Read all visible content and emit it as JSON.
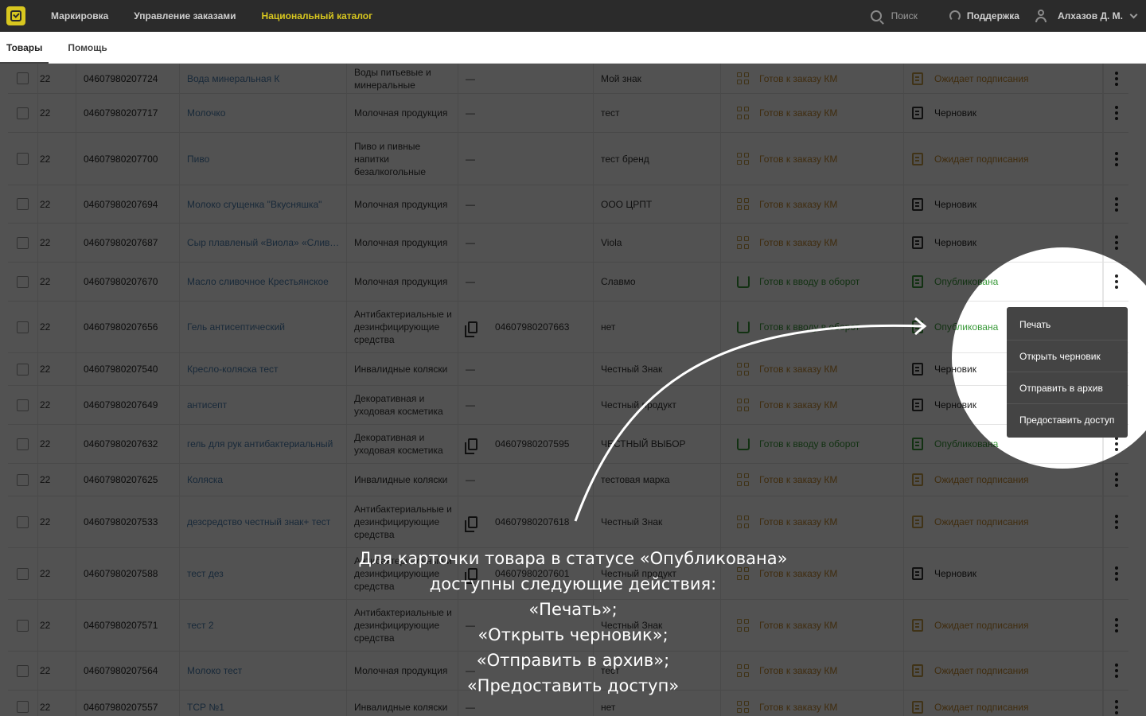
{
  "nav": {
    "items": [
      "Маркировка",
      "Управление заказами",
      "Национальный каталог"
    ],
    "active_index": 2,
    "search_label": "Поиск",
    "support_label": "Поддержка",
    "user_name": "Алхазов Д. М."
  },
  "subtabs": [
    "Товары",
    "Помощь"
  ],
  "rows": [
    {
      "n": "22",
      "gtin": "04607980207724",
      "name": "Вода минеральная К",
      "category": "Воды питьевые и минеральные",
      "pack": "—",
      "brand": "Мой знак",
      "status": "Готов к заказу КМ",
      "status_kind": "order",
      "card": "Ожидает подписания",
      "card_kind": "wait"
    },
    {
      "n": "22",
      "gtin": "04607980207717",
      "name": "Молочко",
      "category": "Молочная продукция",
      "pack": "—",
      "brand": "тест",
      "status": "Готов к заказу КМ",
      "status_kind": "order",
      "card": "Черновик",
      "card_kind": "draft"
    },
    {
      "n": "22",
      "gtin": "04607980207700",
      "name": "Пиво",
      "category": "Пиво и пивные напитки безалкогольные",
      "pack": "—",
      "brand": "тест бренд",
      "status": "Готов к заказу КМ",
      "status_kind": "order",
      "card": "Ожидает подписания",
      "card_kind": "wait"
    },
    {
      "n": "22",
      "gtin": "04607980207694",
      "name": "Молоко сгущенка \"Вкусняшка\"",
      "category": "Молочная продукция",
      "pack": "—",
      "brand": "ООО ЦРПТ",
      "status": "Готов к заказу КМ",
      "status_kind": "order",
      "card": "Черновик",
      "card_kind": "draft"
    },
    {
      "n": "22",
      "gtin": "04607980207687",
      "name": "Сыр плавленый «Виола» «Сливочный»",
      "category": "Молочная продукция",
      "pack": "—",
      "brand": "Viola",
      "status": "Готов к заказу КМ",
      "status_kind": "order",
      "card": "Черновик",
      "card_kind": "draft"
    },
    {
      "n": "22",
      "gtin": "04607980207670",
      "name": "Масло сливочное Крестьянское",
      "category": "Молочная продукция",
      "pack": "—",
      "brand": "Славмо",
      "status": "Готов к вводу в оборот",
      "status_kind": "circ",
      "card": "Опубликована",
      "card_kind": "pub"
    },
    {
      "n": "22",
      "gtin": "04607980207656",
      "name": "Гель антисептический",
      "category": "Антибактериальные и дезинфицирующие средства",
      "pack": "04607980207663",
      "brand": "нет",
      "status": "Готов к вводу в оборот",
      "status_kind": "circ",
      "card": "Опубликована",
      "card_kind": "pub"
    },
    {
      "n": "22",
      "gtin": "04607980207540",
      "name": "Кресло-коляска тест",
      "category": "Инвалидные коляски",
      "pack": "—",
      "brand": "Честный Знак",
      "status": "Готов к заказу КМ",
      "status_kind": "order",
      "card": "Черновик",
      "card_kind": "draft"
    },
    {
      "n": "22",
      "gtin": "04607980207649",
      "name": "антисепт",
      "category": "Декоративная и уходовая косметика",
      "pack": "—",
      "brand": "Честный продукт",
      "status": "Готов к заказу КМ",
      "status_kind": "order",
      "card": "Черновик",
      "card_kind": "draft"
    },
    {
      "n": "22",
      "gtin": "04607980207632",
      "name": "гель для рук антибактериальный",
      "category": "Декоративная и уходовая косметика",
      "pack": "04607980207595",
      "brand": "ЧЕСТНЫЙ ВЫБОР",
      "status": "Готов к вводу в оборот",
      "status_kind": "circ",
      "card": "Опубликована",
      "card_kind": "pub"
    },
    {
      "n": "22",
      "gtin": "04607980207625",
      "name": "Коляска",
      "category": "Инвалидные коляски",
      "pack": "—",
      "brand": "тестовая марка",
      "status": "Готов к заказу КМ",
      "status_kind": "order",
      "card": "Ожидает подписания",
      "card_kind": "wait"
    },
    {
      "n": "22",
      "gtin": "04607980207533",
      "name": "дезсредство честный знак+ тест",
      "category": "Антибактериальные и дезинфицирующие средства",
      "pack": "04607980207618",
      "brand": "Честный Знак",
      "status": "Готов к заказу КМ",
      "status_kind": "order",
      "card": "Ожидает подписания",
      "card_kind": "wait"
    },
    {
      "n": "22",
      "gtin": "04607980207588",
      "name": "тест дез",
      "category": "Антибактериальные и дезинфицирующие средства",
      "pack": "04607980207601",
      "brand": "Честный продукт",
      "status": "Готов к заказу КМ",
      "status_kind": "order",
      "card": "Черновик",
      "card_kind": "draft"
    },
    {
      "n": "22",
      "gtin": "04607980207571",
      "name": "тест 2",
      "category": "Антибактериальные и дезинфицирующие средства",
      "pack": "—",
      "brand": "Честный Знак",
      "status": "Готов к заказу КМ",
      "status_kind": "order",
      "card": "Ожидает подписания",
      "card_kind": "wait"
    },
    {
      "n": "22",
      "gtin": "04607980207564",
      "name": "Молоко тест",
      "category": "Молочная продукция",
      "pack": "—",
      "brand": "тест",
      "status": "Готов к заказу КМ",
      "status_kind": "order",
      "card": "Ожидает подписания",
      "card_kind": "wait"
    },
    {
      "n": "22",
      "gtin": "04607980207557",
      "name": "ТСР №1",
      "category": "Инвалидные коляски",
      "pack": "—",
      "brand": "нет",
      "status": "Готов к заказу КМ",
      "status_kind": "order",
      "card": "Ожидает подписания",
      "card_kind": "wait"
    }
  ],
  "context_menu": [
    "Печать",
    "Открыть черновик",
    "Отправить в архив",
    "Предоставить доступ"
  ],
  "caption": [
    "Для карточки товара в статусе «Опубликована»",
    "доступны следующие действия:",
    "«Печать»;",
    "«Открыть черновик»;",
    "«Отправить в архив»;",
    "«Предоставить доступ»"
  ],
  "colors": {
    "accent": "#d8c71f",
    "orange": "#c4892e",
    "green": "#3a9a3a",
    "link": "#4d7fb0"
  }
}
